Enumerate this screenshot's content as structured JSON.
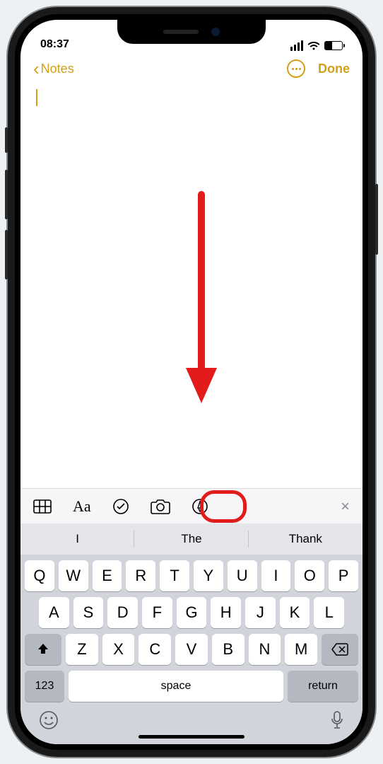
{
  "status": {
    "time": "08:37"
  },
  "nav": {
    "back_label": "Notes",
    "done_label": "Done"
  },
  "note": {
    "content": ""
  },
  "format_bar": {
    "table_icon": "table-icon",
    "text_format": "Aa",
    "checklist_icon": "checklist-icon",
    "camera_icon": "camera-icon",
    "markup_icon": "markup-icon",
    "close": "×"
  },
  "suggestions": [
    "I",
    "The",
    "Thank"
  ],
  "keyboard": {
    "row1": [
      "Q",
      "W",
      "E",
      "R",
      "T",
      "Y",
      "U",
      "I",
      "O",
      "P"
    ],
    "row2": [
      "A",
      "S",
      "D",
      "F",
      "G",
      "H",
      "J",
      "K",
      "L"
    ],
    "row3": [
      "Z",
      "X",
      "C",
      "V",
      "B",
      "N",
      "M"
    ],
    "numeric_label": "123",
    "space_label": "space",
    "return_label": "return"
  }
}
